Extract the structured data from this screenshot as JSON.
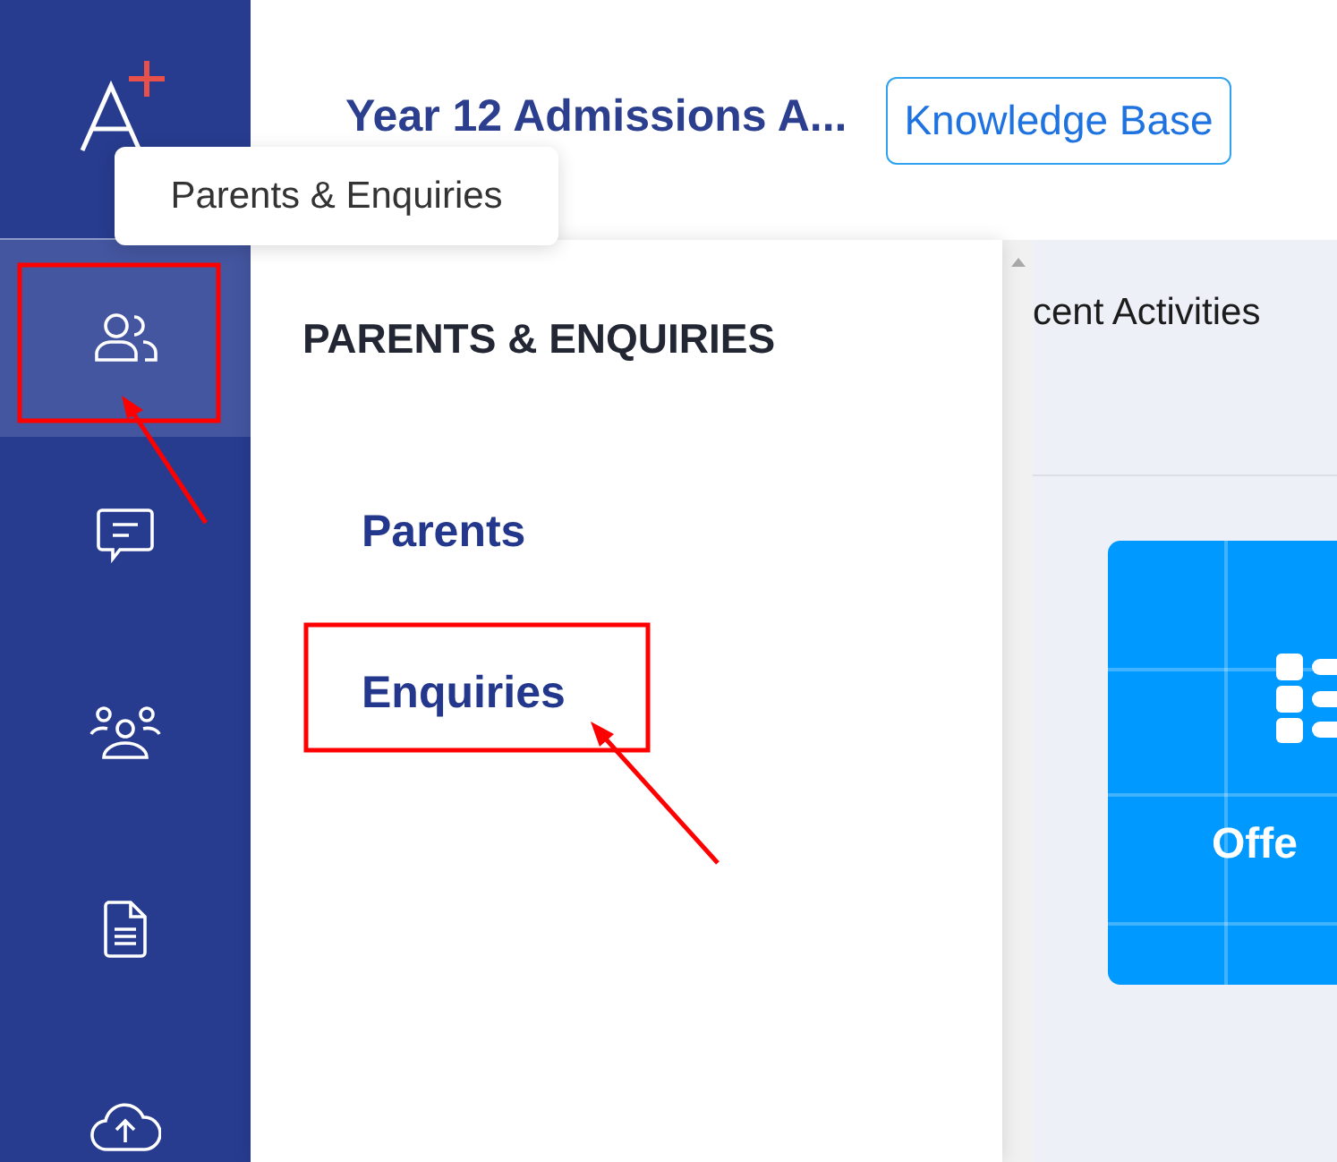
{
  "header": {
    "title": "Year 12 Admissions A...",
    "button": "Knowledge Base"
  },
  "tooltip": "Parents & Enquiries",
  "sidebar": {
    "items": [
      {
        "kind": "people",
        "selected": true
      },
      {
        "kind": "message",
        "selected": false
      },
      {
        "kind": "group",
        "selected": false
      },
      {
        "kind": "document",
        "selected": false
      },
      {
        "kind": "upload",
        "selected": false
      }
    ]
  },
  "flyout": {
    "heading": "PARENTS & ENQUIRIES",
    "items": [
      "Parents",
      "Enquiries"
    ]
  },
  "content": {
    "tab": "cent Activities",
    "tile": "Offe"
  }
}
